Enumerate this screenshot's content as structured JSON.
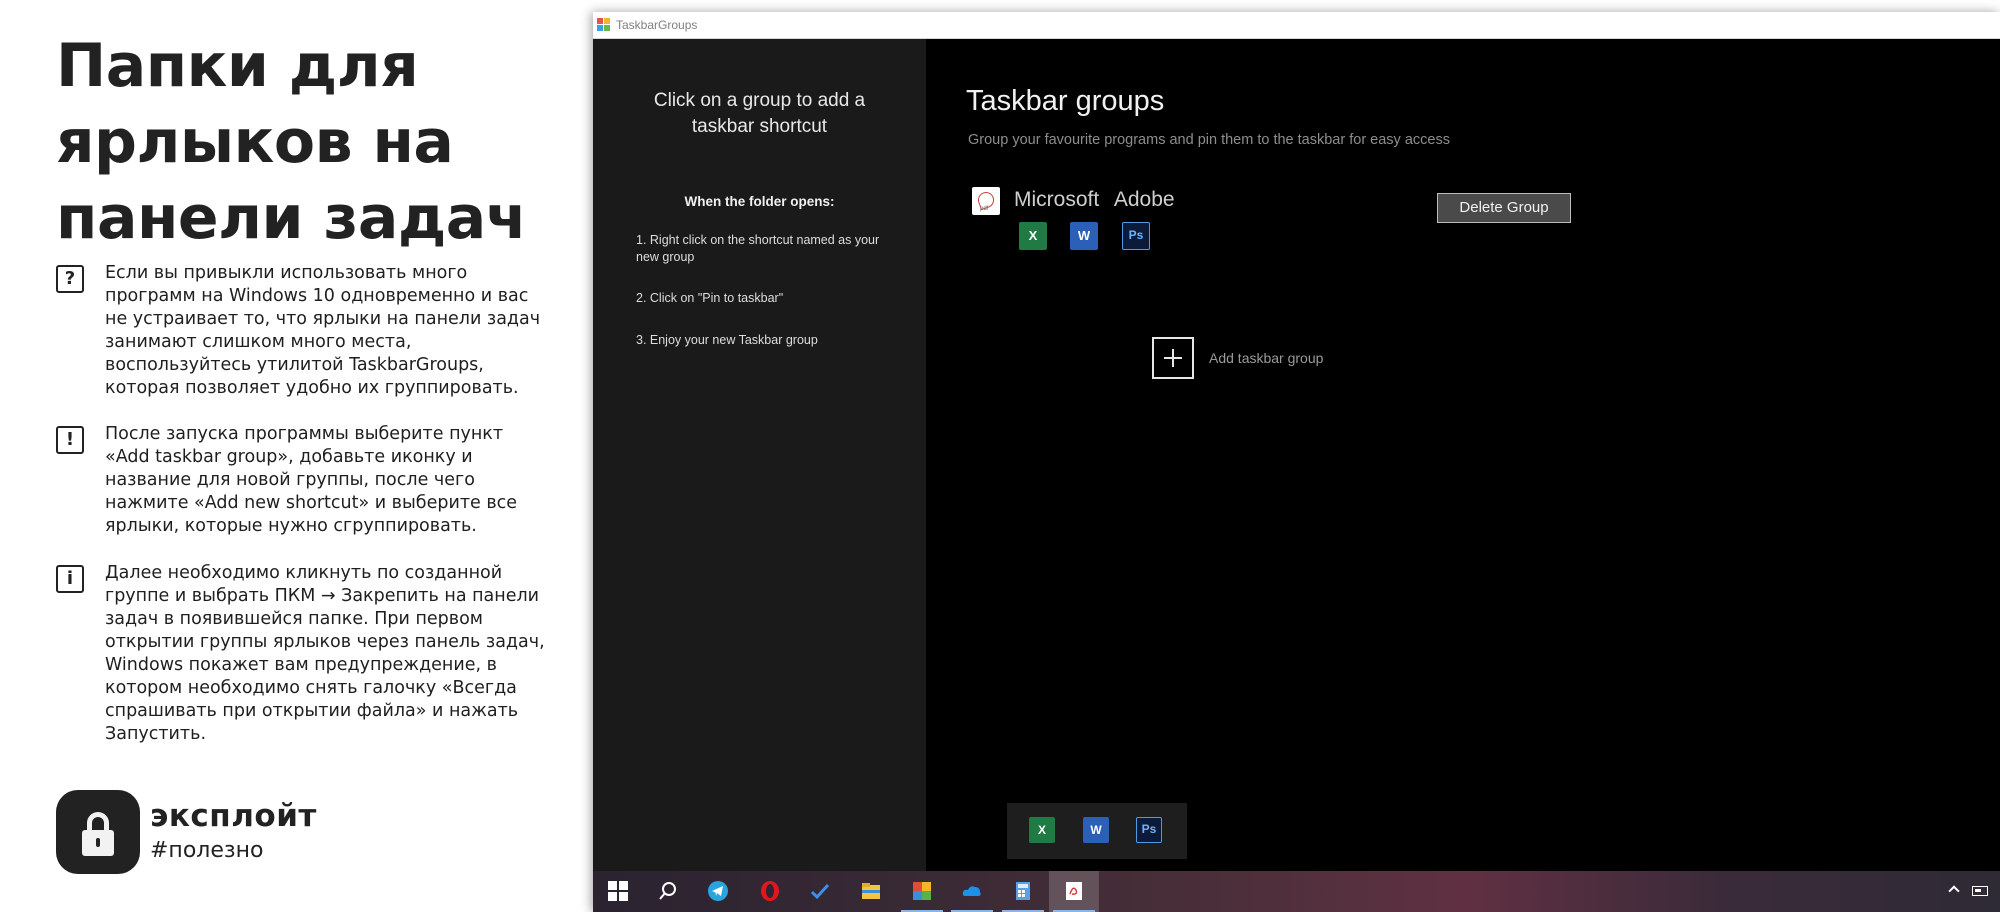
{
  "article": {
    "headline": "Папки для ярлыков на панели задач",
    "tips": [
      {
        "icon": "question-icon",
        "symbol": "?",
        "text": "Если вы привыкли использовать много программ на Windows 10 одновременно и вас не устраивает то, что ярлыки на панели задач занимают слишком много места, воспользуйтесь утилитой TaskbarGroups, которая позволяет удобно их группировать."
      },
      {
        "icon": "exclamation-icon",
        "symbol": "!",
        "text": "После запуска программы выберите пункт «Add taskbar group», добавьте иконку и название для новой группы, после чего нажмите «Add new shortcut» и выберите все ярлыки, которые нужно сгруппировать."
      },
      {
        "icon": "info-icon",
        "symbol": "i",
        "text": "Далее необходимо кликнуть по созданной группе и выбрать ПКМ → Закрепить на панели задач в появившейся папке. При первом открытии группы ярлыков через панель задач, Windows покажет вам предупреждение, в котором необходимо снять галочку «Всегда спрашивать при открытии файла» и нажать Запустить."
      }
    ],
    "brand": {
      "name": "эксплойт",
      "tag": "#полезно"
    }
  },
  "window": {
    "title": "TaskbarGroups",
    "sidebar": {
      "heading": "Click on a group to add a taskbar shortcut",
      "subheading": "When the folder opens:",
      "steps": [
        "1. Right click on the shortcut named as your new group",
        "2. Click on \"Pin to taskbar\"",
        "3. Enjoy your new Taskbar group"
      ]
    },
    "main": {
      "title": "Taskbar groups",
      "subtitle": "Group your favourite programs and pin them to the taskbar for easy access",
      "group": {
        "name": "Microsoft Adobe",
        "icons": [
          "X",
          "W",
          "Ps"
        ]
      },
      "delete_label": "Delete Group",
      "add_label": "Add taskbar group"
    },
    "popup_icons": [
      "X",
      "W",
      "Ps"
    ]
  },
  "taskbar": {
    "items": [
      "start-icon",
      "search-icon",
      "telegram-icon",
      "opera-icon",
      "todo-icon",
      "file-explorer-icon",
      "paint-icon",
      "onedrive-icon",
      "calculator-icon",
      "taskbargroups-icon"
    ]
  },
  "colors": {
    "excel": "#1f7a43",
    "word": "#2b5fb8",
    "photoshop": "#0c1b3a",
    "sidebar_bg": "#1a1a1a",
    "main_bg": "#000000"
  }
}
